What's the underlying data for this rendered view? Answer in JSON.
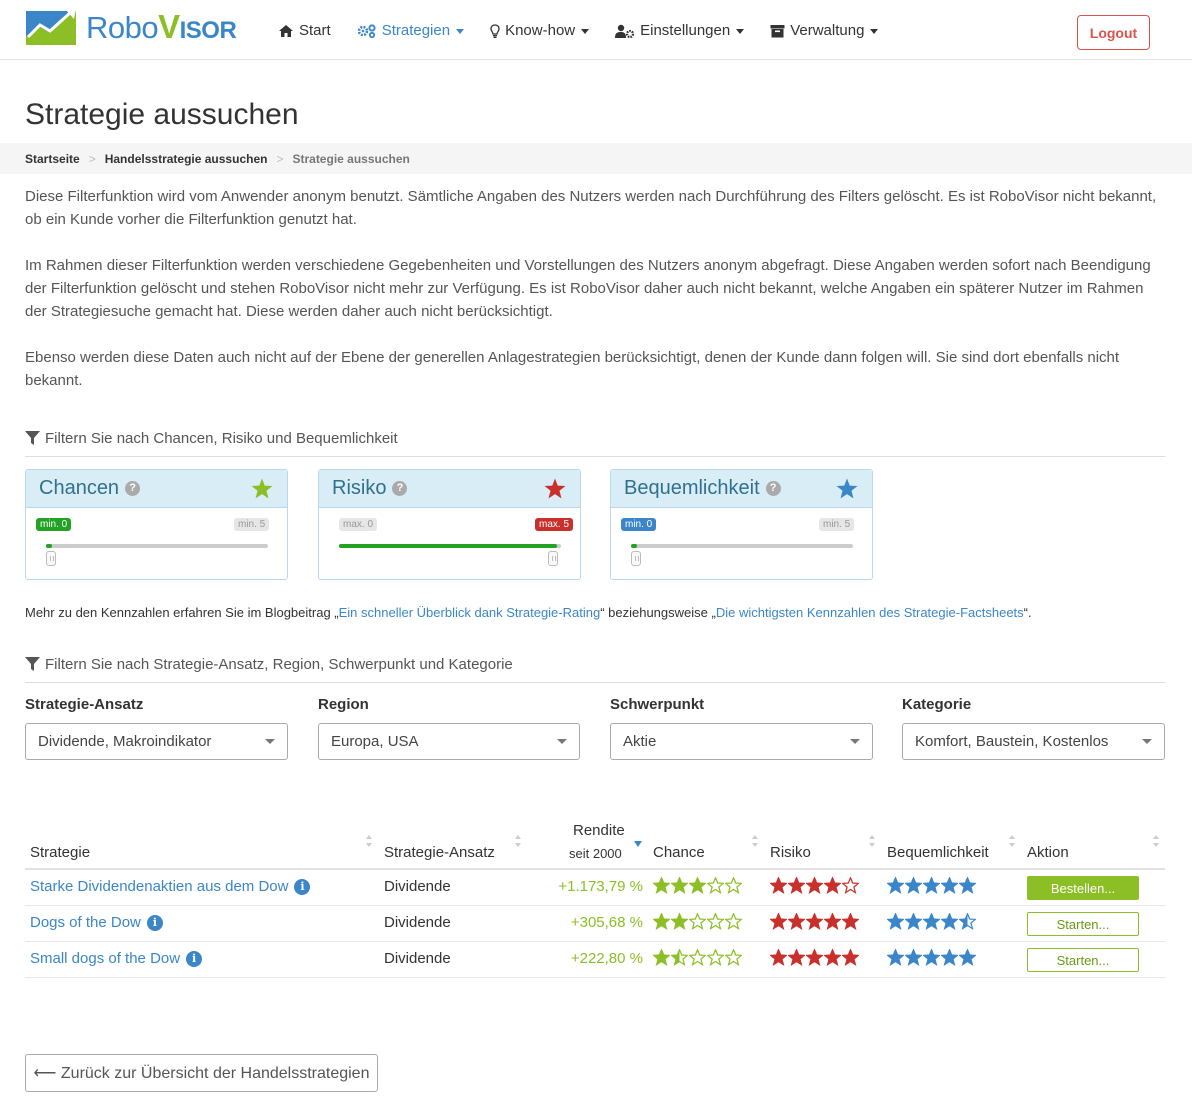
{
  "header": {
    "logo_text_a": "Robo",
    "logo_text_v": "V",
    "logo_text_b": "ISOR",
    "nav": [
      {
        "label": "Start",
        "icon": "home-icon",
        "dropdown": false,
        "active": false
      },
      {
        "label": "Strategien",
        "icon": "cogs-icon",
        "dropdown": true,
        "active": true
      },
      {
        "label": "Know-how",
        "icon": "lightbulb-icon",
        "dropdown": true,
        "active": false
      },
      {
        "label": "Einstellungen",
        "icon": "user-gear-icon",
        "dropdown": true,
        "active": false
      },
      {
        "label": "Verwaltung",
        "icon": "archive-icon",
        "dropdown": true,
        "active": false
      }
    ],
    "logout_label": "Logout"
  },
  "page": {
    "title": "Strategie aussuchen",
    "breadcrumb": [
      "Startseite",
      "Handelsstrategie aussuchen",
      "Strategie aussuchen"
    ],
    "intro": [
      "Diese Filterfunktion wird vom Anwender anonym benutzt. Sämtliche Angaben des Nutzers werden nach Durchführung des Filters gelöscht. Es ist RoboVisor nicht bekannt, ob ein Kunde vorher die Filterfunktion genutzt hat.",
      "Im Rahmen dieser Filterfunktion werden verschiedene Gegebenheiten und Vorstellungen des Nutzers anonym abgefragt. Diese Angaben werden sofort nach Beendigung der Filterfunktion gelöscht und stehen RoboVisor nicht mehr zur Verfügung. Es ist RoboVisor daher auch nicht bekannt, welche Angaben ein späterer Nutzer im Rahmen der Strategiesuche gemacht hat. Diese werden daher auch nicht berücksichtigt.",
      "Ebenso werden diese Daten auch nicht auf der Ebene der generellen Anlagestrategien berücksichtigt, denen der Kunde dann folgen will. Sie sind dort ebenfalls nicht bekannt."
    ]
  },
  "filter1": {
    "heading": "Filtern Sie nach Chancen, Risiko und Bequemlichkeit",
    "cards": [
      {
        "title": "Chancen",
        "help": "?",
        "star_color": "#8cbf26",
        "left_label": "min. 0",
        "right_label": "min. 5",
        "value": 0
      },
      {
        "title": "Risiko",
        "help": "?",
        "star_color": "#c9302c",
        "left_label": "max. 0",
        "right_label": "max. 5",
        "value": 5
      },
      {
        "title": "Bequemlichkeit",
        "help": "?",
        "star_color": "#3b86c9",
        "left_label": "min. 0",
        "right_label": "min. 5",
        "value": 0
      }
    ],
    "note_prefix": "Mehr zu den Kennzahlen erfahren Sie im Blogbeitrag „",
    "note_link1": "Ein schneller Überblick dank Strategie-Rating",
    "note_middle": "“ beziehungsweise „",
    "note_link2": "Die wichtigsten Kennzahlen des Strategie-Factsheets",
    "note_suffix": "“."
  },
  "filter2": {
    "heading": "Filtern Sie nach Strategie-Ansatz, Region, Schwerpunkt und Kategorie",
    "fields": [
      {
        "label": "Strategie-Ansatz",
        "value": "Dividende, Makroindikator"
      },
      {
        "label": "Region",
        "value": "Europa, USA"
      },
      {
        "label": "Schwerpunkt",
        "value": "Aktie"
      },
      {
        "label": "Kategorie",
        "value": "Komfort, Baustein, Kostenlos"
      }
    ]
  },
  "table": {
    "headers": {
      "strategie": "Strategie",
      "ansatz": "Strategie-Ansatz",
      "rendite": "Rendite",
      "rendite_sub": "seit 2000",
      "chance": "Chance",
      "risiko": "Risiko",
      "bequemlichkeit": "Bequemlichkeit",
      "aktion": "Aktion"
    },
    "rows": [
      {
        "name": "Starke Dividendenaktien aus dem Dow",
        "ansatz": "Dividende",
        "rendite": "+1.173,79 %",
        "chance": 3,
        "risiko": 4,
        "bequemlichkeit": 5,
        "action": "Bestellen...",
        "action_filled": true
      },
      {
        "name": "Dogs of the Dow",
        "ansatz": "Dividende",
        "rendite": "+305,68 %",
        "chance": 2,
        "risiko": 5,
        "bequemlichkeit": 4.5,
        "action": "Starten...",
        "action_filled": false
      },
      {
        "name": "Small dogs of the Dow",
        "ansatz": "Dividende",
        "rendite": "+222,80 %",
        "chance": 1.5,
        "risiko": 5,
        "bequemlichkeit": 5,
        "action": "Starten...",
        "action_filled": false
      }
    ],
    "colors": {
      "chance": "#8cbf26",
      "risiko": "#c9302c",
      "bequemlichkeit": "#3b86c9"
    }
  },
  "footer": {
    "back_label": "⟵ Zurück zur Übersicht der Handelsstrategien"
  }
}
